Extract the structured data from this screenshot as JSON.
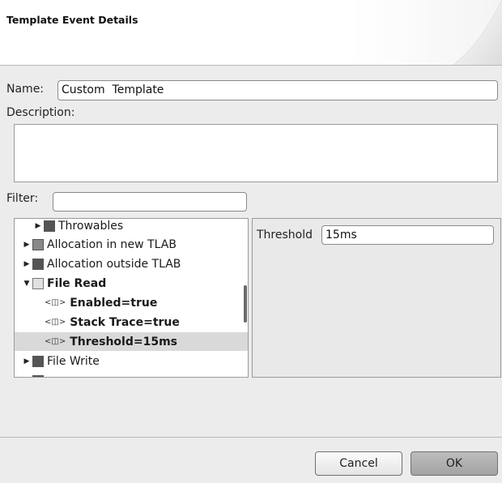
{
  "header": {
    "title": "Template Event Details"
  },
  "form": {
    "name_label": "Name:",
    "name_value": "Custom  Template",
    "description_label": "Description:",
    "description_value": "",
    "filter_label": "Filter:",
    "filter_value": ""
  },
  "tree": {
    "items": [
      {
        "label": "Throwables",
        "expander": "▶"
      },
      {
        "label": "Allocation in new TLAB",
        "expander": "▶"
      },
      {
        "label": "Allocation outside TLAB",
        "expander": "▶"
      },
      {
        "label": "File Read",
        "expander": "▼"
      },
      {
        "label": "Enabled=true"
      },
      {
        "label": "Stack Trace=true"
      },
      {
        "label": "Threshold=15ms"
      },
      {
        "label": "File Write",
        "expander": "▶"
      }
    ],
    "attribute_icon": "attribute-icon",
    "attribute_icon_glyph": "<◫>"
  },
  "detail": {
    "threshold_label": "Threshold",
    "threshold_value": "15ms"
  },
  "buttons": {
    "cancel": "Cancel",
    "ok": "OK"
  }
}
